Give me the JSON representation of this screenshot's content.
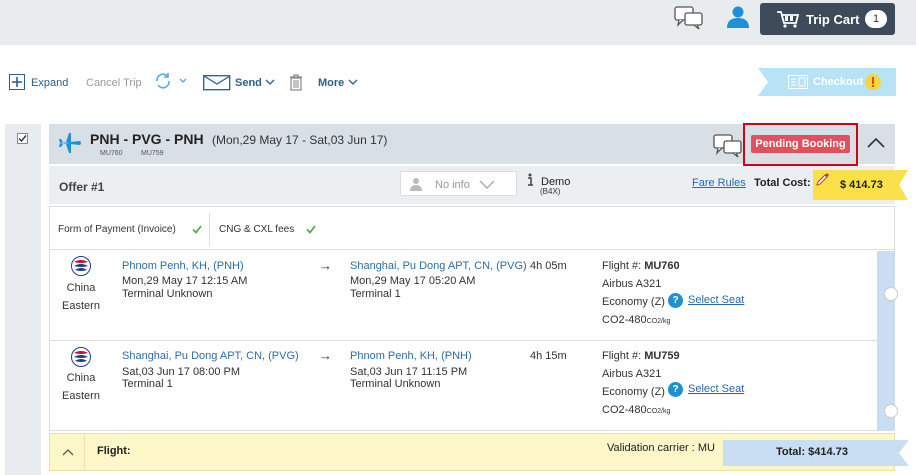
{
  "header": {
    "cart_label": "Trip Cart",
    "cart_count": "1",
    "icons": [
      "chat-icon",
      "user-icon",
      "cart-icon"
    ]
  },
  "toolbar": {
    "expand": "Expand",
    "cancel_trip": "Cancel Trip",
    "send": "Send",
    "more": "More",
    "checkout": "Checkout"
  },
  "trip": {
    "route": "PNH - PVG - PNH",
    "dates": "(Mon,29 May 17 - Sat,03 Jun 17)",
    "flight_codes": [
      "MU760",
      "MU759"
    ],
    "status": "Pending Booking"
  },
  "offer": {
    "label": "Offer #1",
    "no_info": "No info",
    "demo": "Demo",
    "demo_code": "(B4X)",
    "fare_rules": "Fare Rules",
    "total_cost_label": "Total Cost:",
    "total_cost": "$ 414.73"
  },
  "requirements": {
    "form_of_payment": "Form of Payment (Invoice)",
    "cng_fees": "CNG & CXL fees"
  },
  "segments": [
    {
      "airline_line1": "China",
      "airline_line2": "Eastern",
      "from_city": "Phnom Penh, KH, (PNH)",
      "from_time": "Mon,29 May 17 12:15 AM",
      "from_terminal": "Terminal Unknown",
      "arrow": "→",
      "to_city": "Shanghai, Pu Dong APT, CN, (PVG)",
      "to_time": "Mon,29 May 17 05:20 AM",
      "to_terminal": "Terminal 1",
      "duration": "4h 05m",
      "flight_label": "Flight #:",
      "flight_no": "MU760",
      "aircraft": "Airbus A321",
      "cabin": "Economy (Z)",
      "select_seat": "Select Seat",
      "co2": "CO2-480",
      "co2_unit": "CO2/kg"
    },
    {
      "airline_line1": "China",
      "airline_line2": "Eastern",
      "from_city": "Shanghai, Pu Dong APT, CN, (PVG)",
      "from_time": "Sat,03 Jun 17 08:00 PM",
      "from_terminal": "Terminal 1",
      "arrow": "→",
      "to_city": "Phnom Penh, KH, (PNH)",
      "to_time": "Sat,03 Jun 17 11:15 PM",
      "to_terminal": "Terminal Unknown",
      "duration": "4h 15m",
      "flight_label": "Flight #:",
      "flight_no": "MU759",
      "aircraft": "Airbus A321",
      "cabin": "Economy (Z)",
      "select_seat": "Select Seat",
      "co2": "CO2-480",
      "co2_unit": "CO2/kg"
    }
  ],
  "flight_bar": {
    "label": "Flight:",
    "validation": "Validation carrier : MU",
    "total": "Total: $414.73"
  },
  "colors": {
    "pending": "#e2505f",
    "link": "#2469b3",
    "price_tag": "#fbe04a",
    "checkout": "#b8e3f7"
  }
}
